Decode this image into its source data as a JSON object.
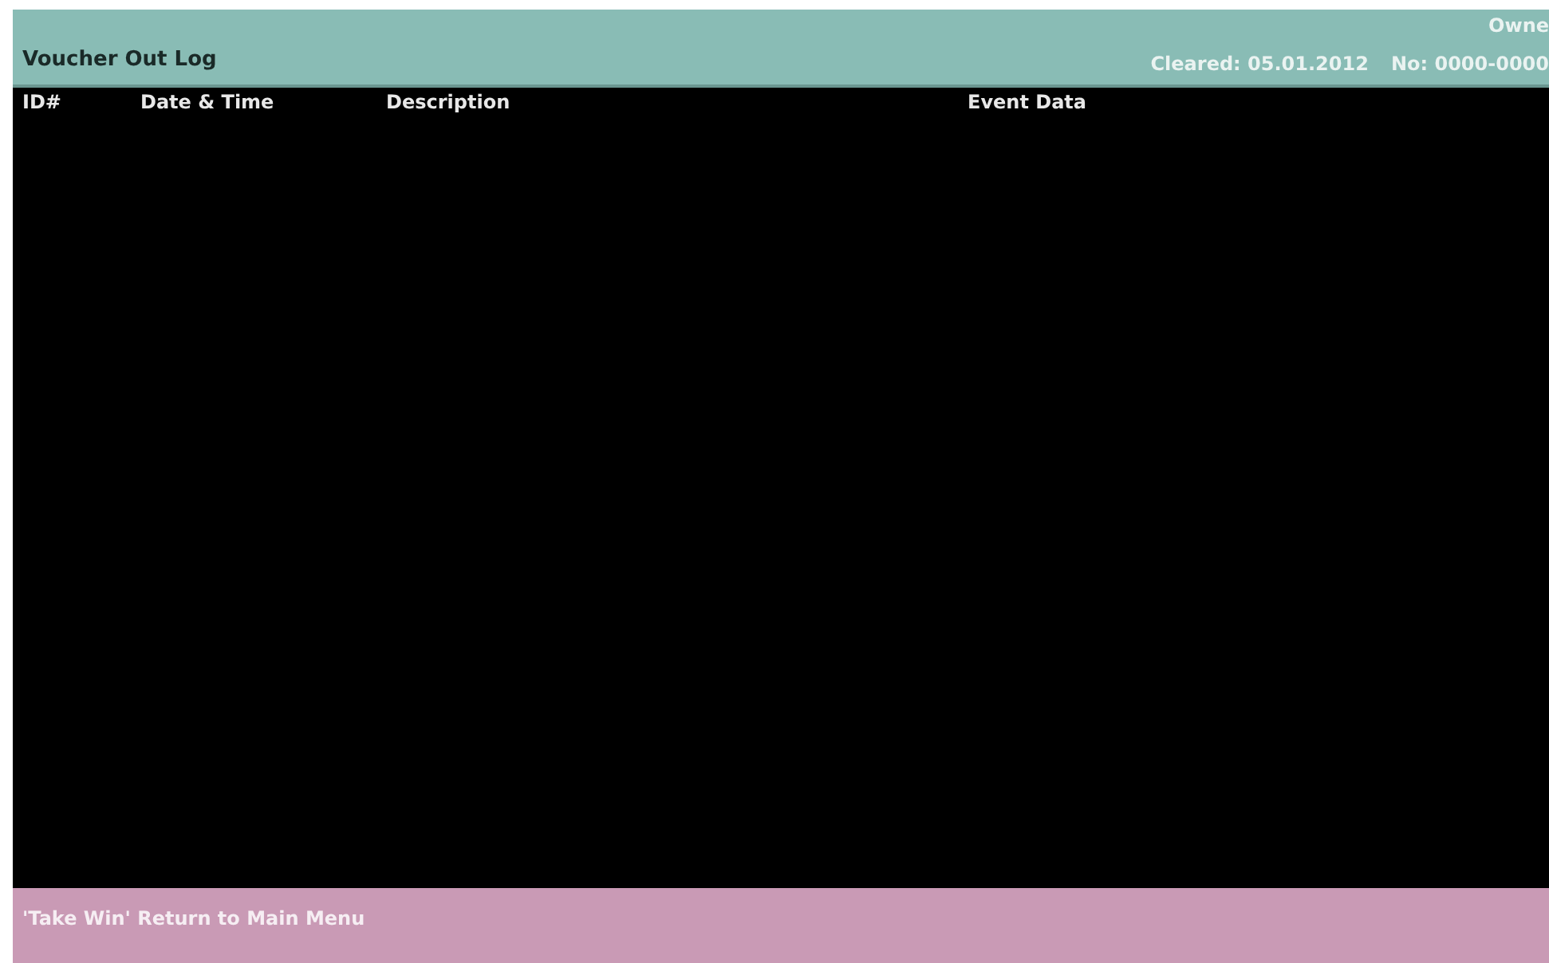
{
  "header": {
    "title": "Voucher Out Log",
    "owner": "Owne",
    "cleared": "Cleared: 05.01.2012",
    "number": "No: 0000-0000"
  },
  "table": {
    "columns": [
      "ID#",
      "Date & Time",
      "Description",
      "Event Data"
    ]
  },
  "footer": {
    "hint": "'Take Win' Return to Main Menu"
  }
}
